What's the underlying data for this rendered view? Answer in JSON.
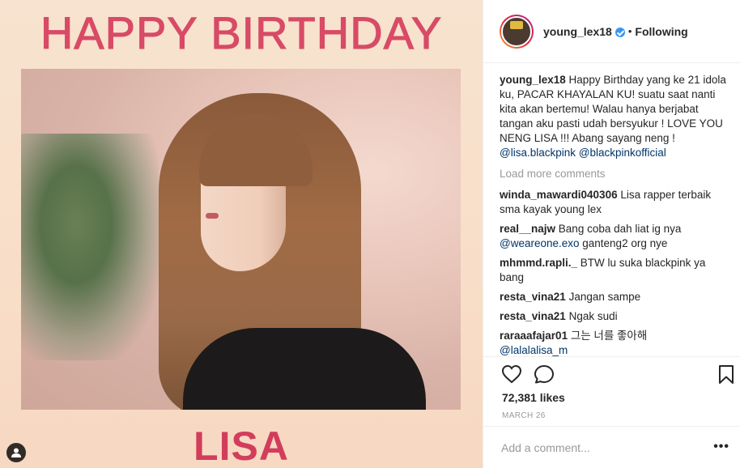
{
  "post": {
    "image": {
      "title": "HAPPY BIRTHDAY",
      "name": "LISA"
    },
    "header": {
      "username": "young_lex18",
      "separator": "•",
      "follow_status": "Following"
    },
    "caption": {
      "username": "young_lex18",
      "text": " Happy Birthday yang ke 21 idola ku, PACAR KHAYALAN KU! suatu saat nanti kita akan bertemu! Walau hanya berjabat tangan aku pasti udah bersyukur ! LOVE YOU NENG LISA !!! Abang sayang neng ! ",
      "mention1": "@lisa.blackpink",
      "mention2": "@blackpinkofficial"
    },
    "load_more": "Load more comments",
    "comments": [
      {
        "user": "winda_mawardi040306",
        "text": " Lisa rapper terbaik sma kayak young lex"
      },
      {
        "user": "real__najw",
        "text": " Bang coba dah liat ig nya ",
        "mention": "@weareone.exo",
        "after": " ganteng2 org nye"
      },
      {
        "user": "mhmmd.rapli._",
        "text": " BTW lu suka blackpink ya bang"
      },
      {
        "user": "resta_vina21",
        "text": " Jangan sampe"
      },
      {
        "user": "resta_vina21",
        "text": " Ngak sudi"
      },
      {
        "user": "raraaafajar01",
        "text": " 그는 너를 좋아해 ",
        "mention": "@lalalalisa_m"
      }
    ],
    "likes": "72,381 likes",
    "date": "MARCH 26",
    "add_comment_placeholder": "Add a comment...",
    "more_options": "•••",
    "colors": {
      "title_pink": "#d84a66",
      "name_pink": "#d23d5c",
      "link_blue": "#003569",
      "verified_blue": "#3897f0"
    },
    "icons": [
      "heart-icon",
      "comment-icon",
      "bookmark-icon",
      "verified-icon",
      "user-tag-icon"
    ]
  }
}
